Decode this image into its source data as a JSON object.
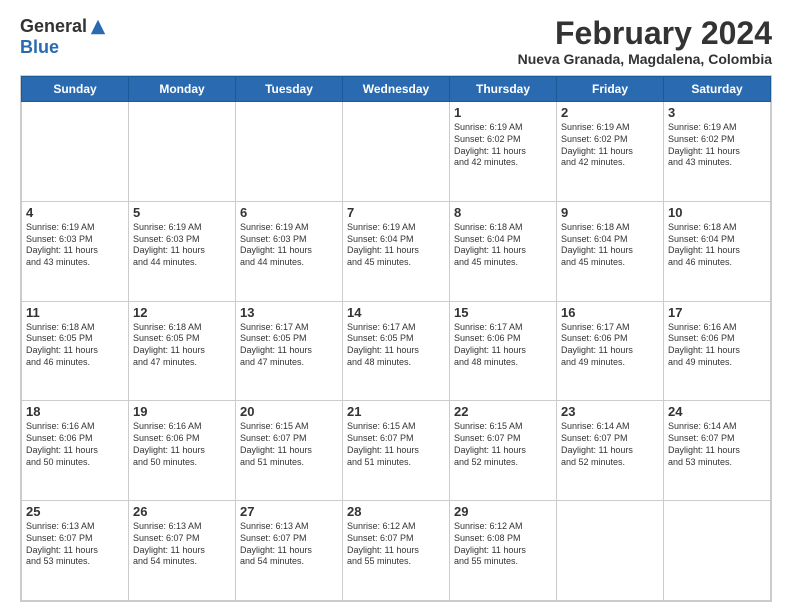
{
  "logo": {
    "general": "General",
    "blue": "Blue"
  },
  "title": "February 2024",
  "subtitle": "Nueva Granada, Magdalena, Colombia",
  "days_of_week": [
    "Sunday",
    "Monday",
    "Tuesday",
    "Wednesday",
    "Thursday",
    "Friday",
    "Saturday"
  ],
  "weeks": [
    [
      {
        "day": "",
        "info": ""
      },
      {
        "day": "",
        "info": ""
      },
      {
        "day": "",
        "info": ""
      },
      {
        "day": "",
        "info": ""
      },
      {
        "day": "1",
        "info": "Sunrise: 6:19 AM\nSunset: 6:02 PM\nDaylight: 11 hours\nand 42 minutes."
      },
      {
        "day": "2",
        "info": "Sunrise: 6:19 AM\nSunset: 6:02 PM\nDaylight: 11 hours\nand 42 minutes."
      },
      {
        "day": "3",
        "info": "Sunrise: 6:19 AM\nSunset: 6:02 PM\nDaylight: 11 hours\nand 43 minutes."
      }
    ],
    [
      {
        "day": "4",
        "info": "Sunrise: 6:19 AM\nSunset: 6:03 PM\nDaylight: 11 hours\nand 43 minutes."
      },
      {
        "day": "5",
        "info": "Sunrise: 6:19 AM\nSunset: 6:03 PM\nDaylight: 11 hours\nand 44 minutes."
      },
      {
        "day": "6",
        "info": "Sunrise: 6:19 AM\nSunset: 6:03 PM\nDaylight: 11 hours\nand 44 minutes."
      },
      {
        "day": "7",
        "info": "Sunrise: 6:19 AM\nSunset: 6:04 PM\nDaylight: 11 hours\nand 45 minutes."
      },
      {
        "day": "8",
        "info": "Sunrise: 6:18 AM\nSunset: 6:04 PM\nDaylight: 11 hours\nand 45 minutes."
      },
      {
        "day": "9",
        "info": "Sunrise: 6:18 AM\nSunset: 6:04 PM\nDaylight: 11 hours\nand 45 minutes."
      },
      {
        "day": "10",
        "info": "Sunrise: 6:18 AM\nSunset: 6:04 PM\nDaylight: 11 hours\nand 46 minutes."
      }
    ],
    [
      {
        "day": "11",
        "info": "Sunrise: 6:18 AM\nSunset: 6:05 PM\nDaylight: 11 hours\nand 46 minutes."
      },
      {
        "day": "12",
        "info": "Sunrise: 6:18 AM\nSunset: 6:05 PM\nDaylight: 11 hours\nand 47 minutes."
      },
      {
        "day": "13",
        "info": "Sunrise: 6:17 AM\nSunset: 6:05 PM\nDaylight: 11 hours\nand 47 minutes."
      },
      {
        "day": "14",
        "info": "Sunrise: 6:17 AM\nSunset: 6:05 PM\nDaylight: 11 hours\nand 48 minutes."
      },
      {
        "day": "15",
        "info": "Sunrise: 6:17 AM\nSunset: 6:06 PM\nDaylight: 11 hours\nand 48 minutes."
      },
      {
        "day": "16",
        "info": "Sunrise: 6:17 AM\nSunset: 6:06 PM\nDaylight: 11 hours\nand 49 minutes."
      },
      {
        "day": "17",
        "info": "Sunrise: 6:16 AM\nSunset: 6:06 PM\nDaylight: 11 hours\nand 49 minutes."
      }
    ],
    [
      {
        "day": "18",
        "info": "Sunrise: 6:16 AM\nSunset: 6:06 PM\nDaylight: 11 hours\nand 50 minutes."
      },
      {
        "day": "19",
        "info": "Sunrise: 6:16 AM\nSunset: 6:06 PM\nDaylight: 11 hours\nand 50 minutes."
      },
      {
        "day": "20",
        "info": "Sunrise: 6:15 AM\nSunset: 6:07 PM\nDaylight: 11 hours\nand 51 minutes."
      },
      {
        "day": "21",
        "info": "Sunrise: 6:15 AM\nSunset: 6:07 PM\nDaylight: 11 hours\nand 51 minutes."
      },
      {
        "day": "22",
        "info": "Sunrise: 6:15 AM\nSunset: 6:07 PM\nDaylight: 11 hours\nand 52 minutes."
      },
      {
        "day": "23",
        "info": "Sunrise: 6:14 AM\nSunset: 6:07 PM\nDaylight: 11 hours\nand 52 minutes."
      },
      {
        "day": "24",
        "info": "Sunrise: 6:14 AM\nSunset: 6:07 PM\nDaylight: 11 hours\nand 53 minutes."
      }
    ],
    [
      {
        "day": "25",
        "info": "Sunrise: 6:13 AM\nSunset: 6:07 PM\nDaylight: 11 hours\nand 53 minutes."
      },
      {
        "day": "26",
        "info": "Sunrise: 6:13 AM\nSunset: 6:07 PM\nDaylight: 11 hours\nand 54 minutes."
      },
      {
        "day": "27",
        "info": "Sunrise: 6:13 AM\nSunset: 6:07 PM\nDaylight: 11 hours\nand 54 minutes."
      },
      {
        "day": "28",
        "info": "Sunrise: 6:12 AM\nSunset: 6:07 PM\nDaylight: 11 hours\nand 55 minutes."
      },
      {
        "day": "29",
        "info": "Sunrise: 6:12 AM\nSunset: 6:08 PM\nDaylight: 11 hours\nand 55 minutes."
      },
      {
        "day": "",
        "info": ""
      },
      {
        "day": "",
        "info": ""
      }
    ]
  ]
}
